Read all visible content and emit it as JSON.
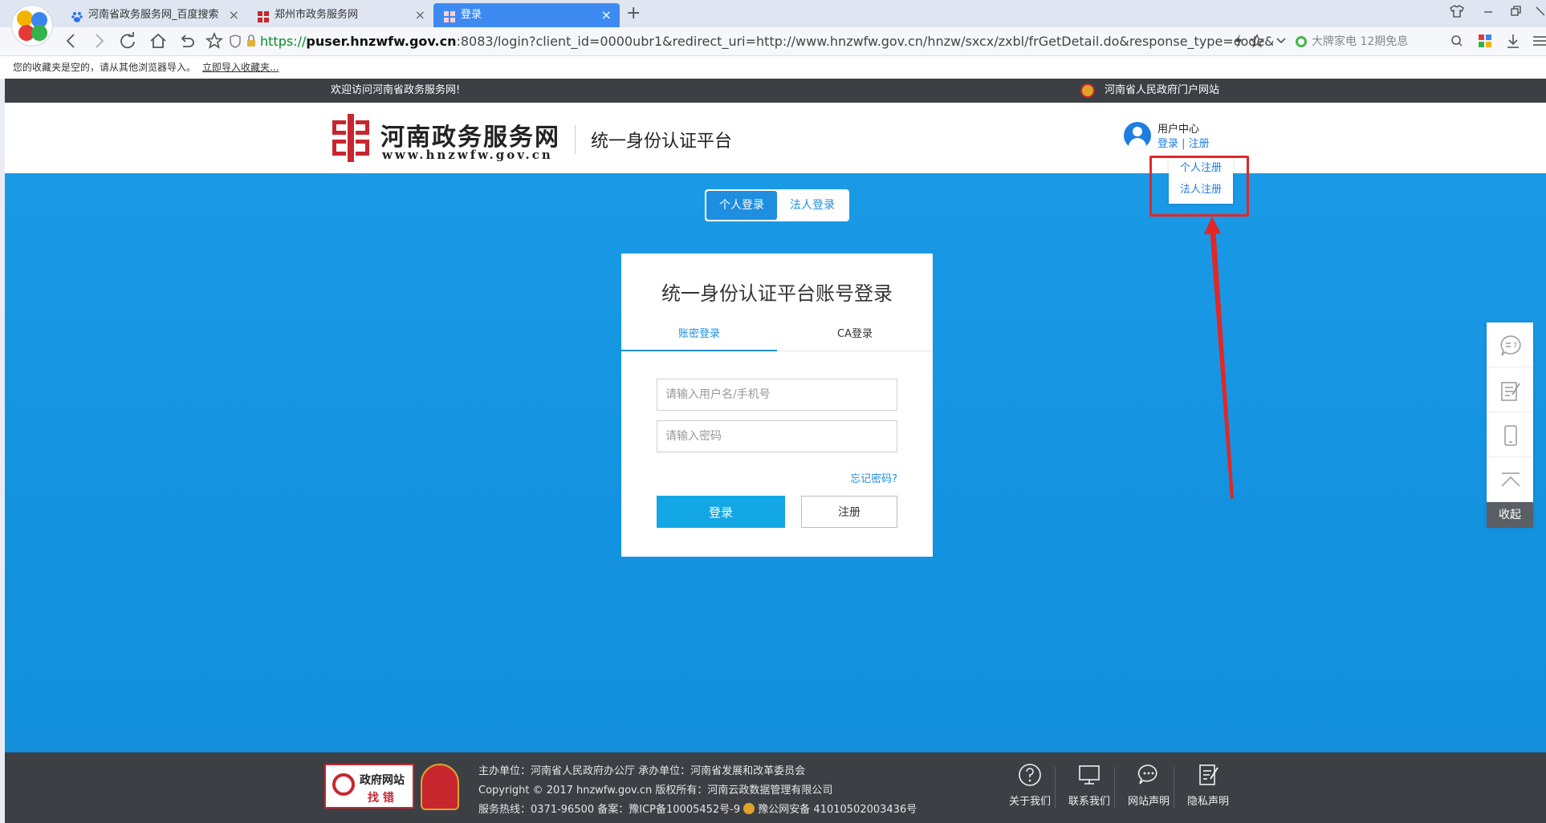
{
  "browser": {
    "tabs": [
      {
        "label": "河南省政务服务网_百度搜索",
        "close": "×"
      },
      {
        "label": "郑州市政务服务网",
        "close": "×"
      },
      {
        "label": "登录",
        "close": "×"
      }
    ],
    "new_tab": "+",
    "url_scheme": "https://",
    "url_host": "puser.hnzwfw.gov.cn",
    "url_rest": ":8083/login?client_id=0000ubr1&redirect_uri=http://www.hnzwfw.gov.cn/hnzw/sxcx/zxbl/frGetDetail.do&response_type=code&sc",
    "search_hint": "大牌家电 12期免息",
    "bookmark_notice": "您的收藏夹是空的，请从其他浏览器导入。",
    "bookmark_import": "立即导入收藏夹..."
  },
  "site": {
    "welcome": "欢迎访问河南省政务服务网!",
    "portal_link": "河南省人民政府门户网站",
    "logo_cn": "河南政务服务网",
    "logo_url": "www.hnzwfw.gov.cn",
    "platform_title": "统一身份认证平台",
    "user_center": {
      "label": "用户中心",
      "login": "登录",
      "sep": " | ",
      "register": "注册"
    },
    "register_menu": [
      "个人注册",
      "法人注册"
    ]
  },
  "login": {
    "type_tabs": [
      "个人登录",
      "法人登录"
    ],
    "card_title": "统一身份认证平台账号登录",
    "method_tabs": [
      "账密登录",
      "CA登录"
    ],
    "username_placeholder": "请输入用户名/手机号",
    "password_placeholder": "请输入密码",
    "forgot": "忘记密码?",
    "login_button": "登录",
    "register_button": "注册"
  },
  "side_toolbar": {
    "collapse": "收起"
  },
  "footer": {
    "badge_line1": "政府网站",
    "badge_line2": "找 错",
    "line1": "主办单位：河南省人民政府办公厅   承办单位：河南省发展和改革委员会",
    "line2": "Copyright © 2017 hnzwfw.gov.cn    版权所有：河南云政数据管理有限公司",
    "line3": "服务热线：0371-96500    备案：豫ICP备10005452号-9",
    "police": "豫公网安备 41010502003436号",
    "links": [
      "关于我们",
      "联系我们",
      "网站声明",
      "隐私声明"
    ]
  },
  "colors": {
    "main_blue": "#1392e0",
    "accent": "#1e8ee0",
    "highlight_red": "#e12727"
  }
}
